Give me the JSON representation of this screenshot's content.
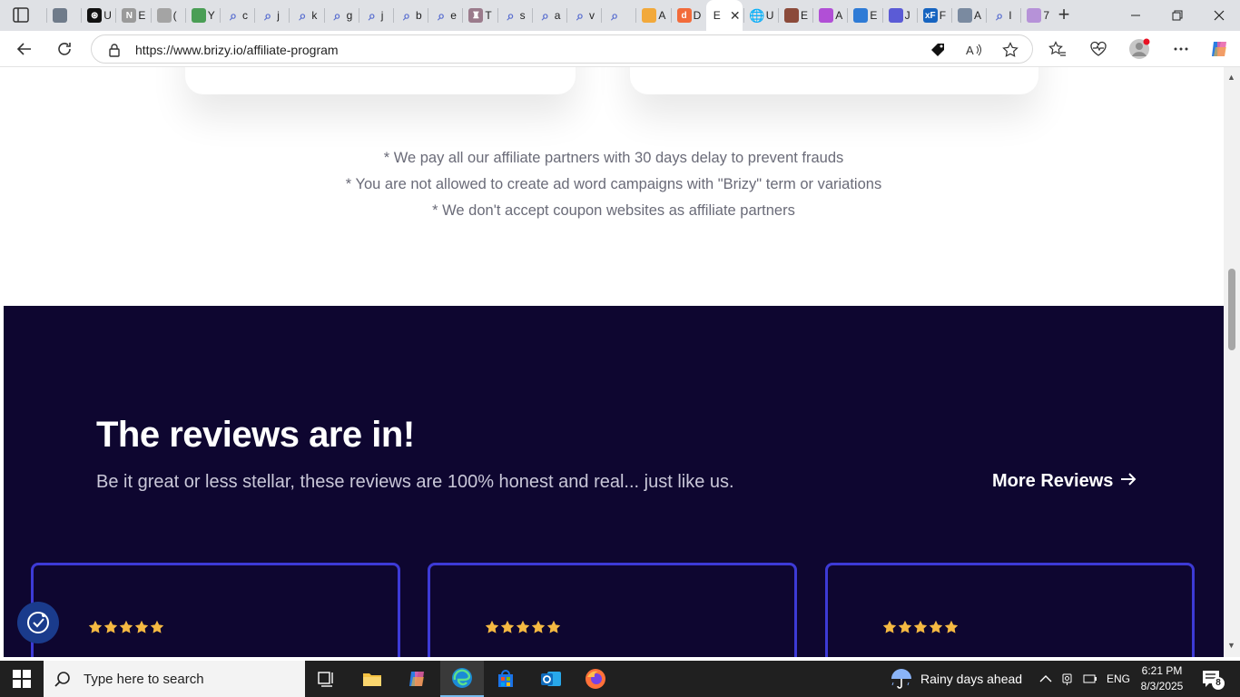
{
  "browser": {
    "tabs": [
      {
        "label": "",
        "icon": "chart-icon"
      },
      {
        "label": "U",
        "icon": "openai-icon"
      },
      {
        "label": "E",
        "icon": "notion-icon"
      },
      {
        "label": "(",
        "icon": "grammarly-icon"
      },
      {
        "label": "Y",
        "icon": "maps-icon"
      },
      {
        "label": "c",
        "icon": "search-icon"
      },
      {
        "label": "j",
        "icon": "search-icon"
      },
      {
        "label": "k",
        "icon": "search-icon"
      },
      {
        "label": "g",
        "icon": "search-icon"
      },
      {
        "label": "j",
        "icon": "search-icon"
      },
      {
        "label": "b",
        "icon": "search-icon"
      },
      {
        "label": "e",
        "icon": "search-icon"
      },
      {
        "label": "T",
        "icon": "castle-icon"
      },
      {
        "label": "s",
        "icon": "search-icon"
      },
      {
        "label": "a",
        "icon": "search-icon"
      },
      {
        "label": "v",
        "icon": "search-icon"
      },
      {
        "label": "",
        "icon": "search-icon"
      },
      {
        "label": "A",
        "icon": "shield-icon"
      },
      {
        "label": "D",
        "icon": "d-app-icon"
      }
    ],
    "active_tab": {
      "label": "E",
      "close": "✕"
    },
    "tabs_after": [
      {
        "label": "U",
        "icon": "globe-icon"
      },
      {
        "label": "E",
        "icon": "avatar-icon"
      },
      {
        "label": "A",
        "icon": "app-icon"
      },
      {
        "label": "E",
        "icon": "wave-icon"
      },
      {
        "label": "J",
        "icon": "diamond-icon"
      },
      {
        "label": "F",
        "icon": "xf-icon"
      },
      {
        "label": "A",
        "icon": "cloud-icon"
      },
      {
        "label": "I",
        "icon": "search-icon"
      },
      {
        "label": "7",
        "icon": "ring-icon"
      }
    ],
    "url": "https://www.brizy.io/affiliate-program"
  },
  "page": {
    "notes": [
      "* We pay all our affiliate partners with 30 days delay to prevent frauds",
      "* You are not allowed to create ad word campaigns with \"Brizy\" term or variations",
      "* We don't accept coupon websites as affiliate partners"
    ],
    "reviews": {
      "title": "The reviews are in!",
      "subtitle": "Be it great or less stellar, these reviews are 100% honest and real... just like us.",
      "more_link": "More Reviews",
      "cards": [
        {
          "rating": 5
        },
        {
          "rating": 5
        },
        {
          "rating": 5
        }
      ]
    }
  },
  "taskbar": {
    "search_placeholder": "Type here to search",
    "weather": "Rainy days ahead",
    "language": "ENG",
    "time": "6:21 PM",
    "date": "8/3/2025",
    "notifications": "8"
  },
  "colors": {
    "dark_section": "#0e0630",
    "card_border": "#3d3ad6",
    "star": "#f5b942",
    "note_text": "#6a6b78"
  }
}
